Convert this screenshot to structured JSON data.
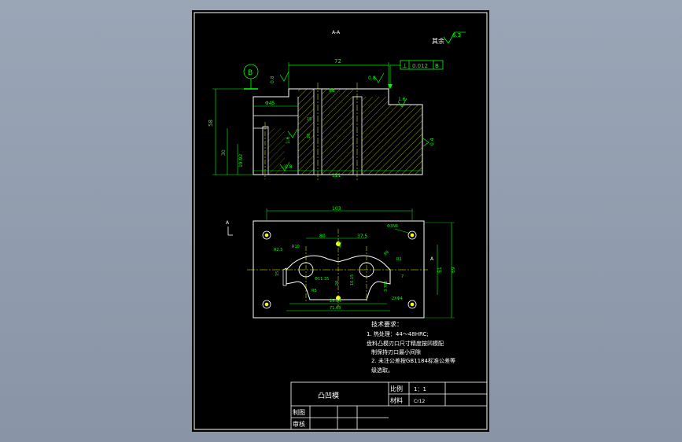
{
  "section_label": "A-A",
  "roughness": {
    "rest_label": "其余",
    "rest_value": "6.3",
    "face_value": "0.8",
    "top_value": "0.8",
    "bottom_value": "0.8",
    "right_value": "0.4",
    "inner_value": "1.6",
    "slot_value": "1.6"
  },
  "datum": {
    "letter": "B"
  },
  "tolerance": {
    "symbol": "⊥",
    "value": "0.012",
    "datum": "B"
  },
  "section_dims": {
    "top_width": "72",
    "step_width": "Φ45",
    "total_height": "58",
    "mid_height": "30",
    "hole_height": "19.92",
    "pilot": "88",
    "fifteen": "15",
    "twenty": "20",
    "bottom_width": "121"
  },
  "plan_dims": {
    "width": "103",
    "left_80": "80",
    "right_375": "37.5",
    "r8": "Φ3N6",
    "r25": "R2.5",
    "r10": "R10",
    "r1": "R1",
    "r5": "R5",
    "phi1135": "Φ11.35",
    "d25": "25.84",
    "d71": "71.63",
    "height_51": "51",
    "height_69": "69",
    "two_a": "2XΦ4",
    "small_98": "98",
    "side_a": "A",
    "side_a_top": "A",
    "v41": "4.1",
    "v15": "15",
    "v37": "3.785",
    "v1015": "10.15",
    "v20": "20",
    "v7": "7"
  },
  "notes": {
    "title": "技术要求：",
    "lines": [
      "1. 热处理：44～48HRC;",
      "  盘料凸模刃口尺寸精度按凹模配",
      "制保持刃口最小间隙",
      "2. 未注公差按GB1184标准公差等",
      "级选取。"
    ]
  },
  "title_block": {
    "part_name": "凸凹模",
    "scale_label": "比例",
    "scale_value": "1：1",
    "material_label": "材料",
    "material_value": "Cr12",
    "drawn_label": "制图",
    "checked_label": "审核"
  },
  "colors": {
    "outline": "#ffffff",
    "dimension": "#00ff00",
    "hatch": "#ffff00",
    "center": "#ffff00",
    "sheet": "#000000",
    "background": "#8e9aab"
  }
}
